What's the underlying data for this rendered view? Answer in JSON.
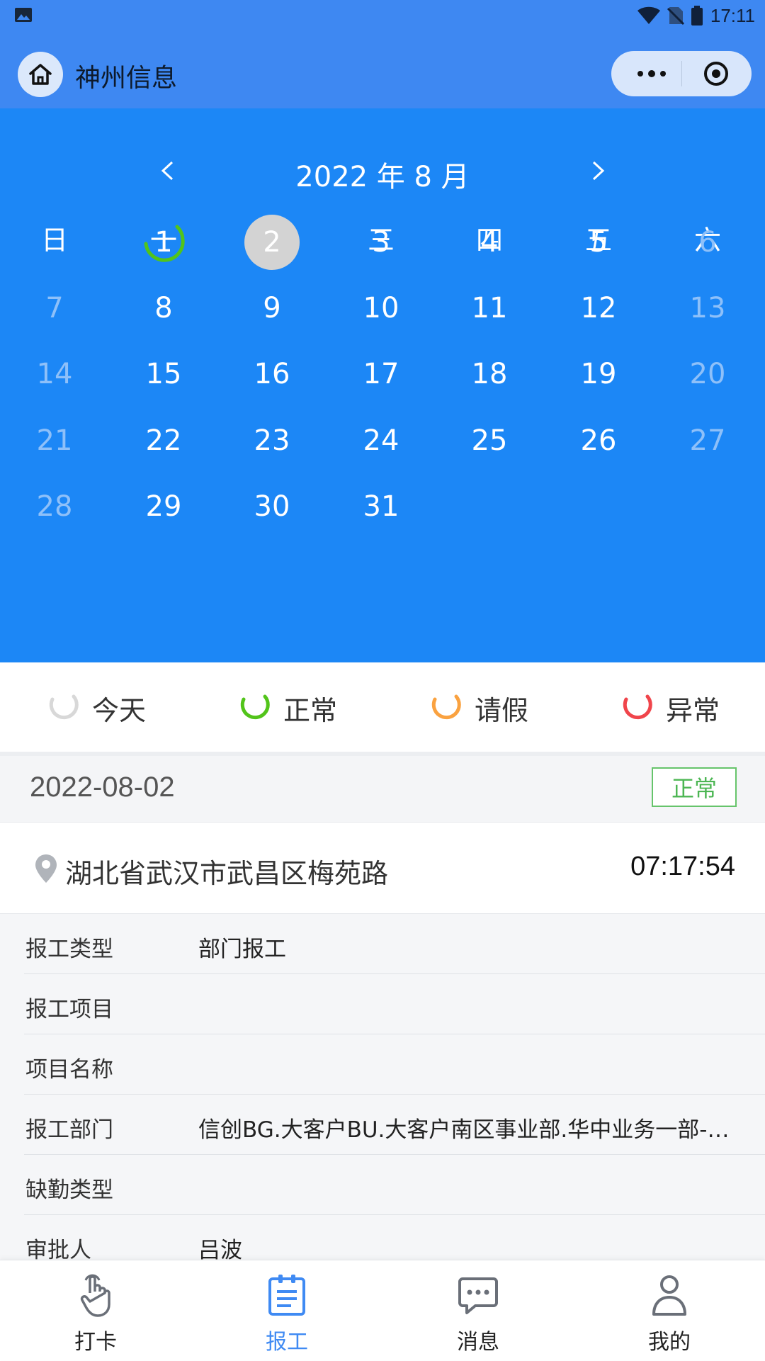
{
  "status_bar": {
    "time": "17:11"
  },
  "app_bar": {
    "title": "神州信息"
  },
  "calendar": {
    "title": "2022 年 8 月",
    "weekdays": [
      "日",
      "一",
      "二",
      "三",
      "四",
      "五",
      "六"
    ],
    "weeks": [
      [
        {
          "d": ""
        },
        {
          "d": "1",
          "state": "normal"
        },
        {
          "d": "2",
          "state": "selected"
        },
        {
          "d": "3"
        },
        {
          "d": "4"
        },
        {
          "d": "5"
        },
        {
          "d": "6",
          "muted": true
        }
      ],
      [
        {
          "d": "7",
          "muted": true
        },
        {
          "d": "8"
        },
        {
          "d": "9"
        },
        {
          "d": "10"
        },
        {
          "d": "11"
        },
        {
          "d": "12"
        },
        {
          "d": "13",
          "muted": true
        }
      ],
      [
        {
          "d": "14",
          "muted": true
        },
        {
          "d": "15"
        },
        {
          "d": "16"
        },
        {
          "d": "17"
        },
        {
          "d": "18"
        },
        {
          "d": "19"
        },
        {
          "d": "20",
          "muted": true
        }
      ],
      [
        {
          "d": "21",
          "muted": true
        },
        {
          "d": "22"
        },
        {
          "d": "23"
        },
        {
          "d": "24"
        },
        {
          "d": "25"
        },
        {
          "d": "26"
        },
        {
          "d": "27",
          "muted": true
        }
      ],
      [
        {
          "d": "28",
          "muted": true
        },
        {
          "d": "29"
        },
        {
          "d": "30"
        },
        {
          "d": "31"
        },
        {
          "d": ""
        },
        {
          "d": ""
        },
        {
          "d": ""
        }
      ]
    ]
  },
  "legend": {
    "today": "今天",
    "normal": "正常",
    "leave": "请假",
    "abnormal": "异常"
  },
  "colors": {
    "calendar_bg": "#1c87f6",
    "normal": "#52c41a",
    "leave": "#faa240",
    "abnormal": "#f0454b",
    "today": "#d8d8d8",
    "active_tab": "#3f8af3"
  },
  "record": {
    "date": "2022-08-02",
    "status": "正常",
    "address": "湖北省武汉市武昌区梅苑路",
    "time": "07:17:54"
  },
  "details": {
    "rows": [
      {
        "k": "报工类型",
        "v": "部门报工"
      },
      {
        "k": "报工项目",
        "v": ""
      },
      {
        "k": "项目名称",
        "v": ""
      },
      {
        "k": "报工部门",
        "v": "信创BG.大客户BU.大客户南区事业部.华中业务一部-…"
      },
      {
        "k": "缺勤类型",
        "v": ""
      },
      {
        "k": "审批人",
        "v": "吕波"
      }
    ]
  },
  "tabs": {
    "checkin": "打卡",
    "report": "报工",
    "messages": "消息",
    "mine": "我的"
  }
}
